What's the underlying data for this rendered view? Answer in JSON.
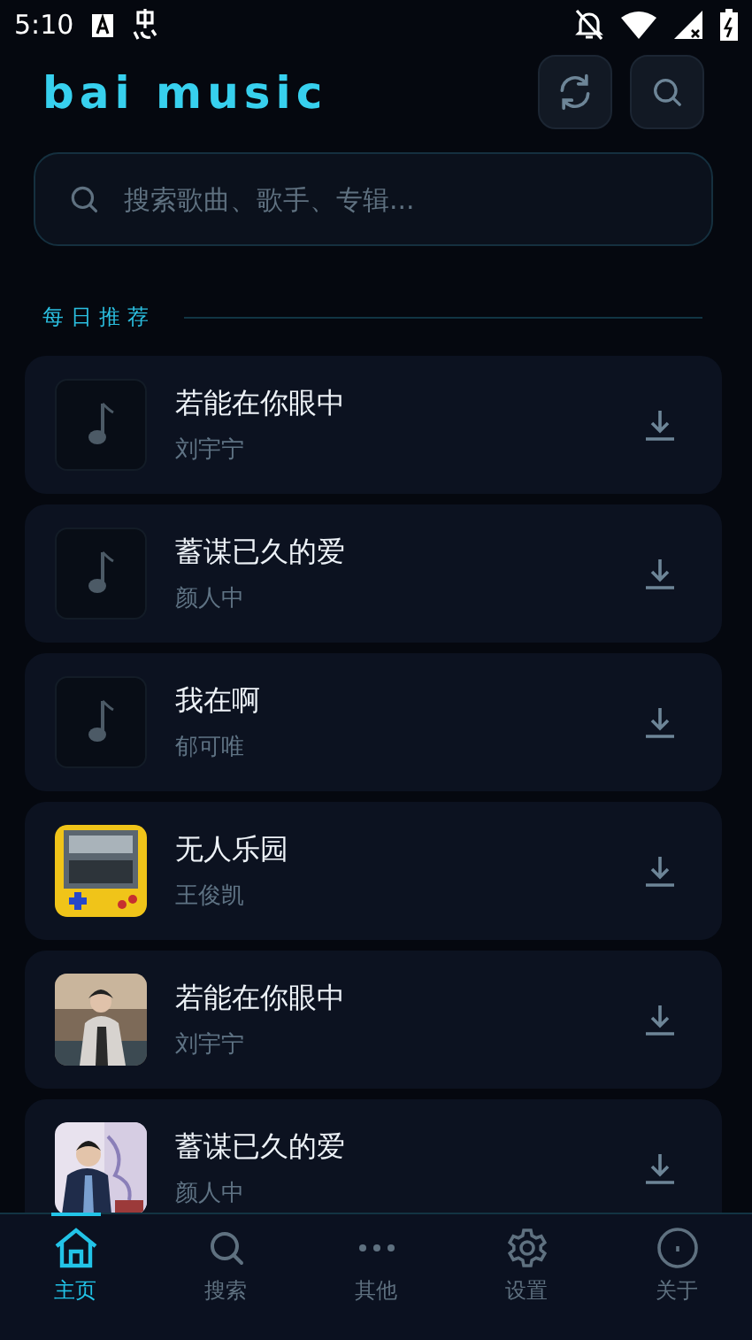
{
  "status_bar": {
    "time": "5:10"
  },
  "header": {
    "title": "bai music"
  },
  "search": {
    "placeholder": "搜索歌曲、歌手、专辑..."
  },
  "section": {
    "title": "每日推荐"
  },
  "songs": [
    {
      "title": "若能在你眼中",
      "artist": "刘宇宁",
      "kind": "note"
    },
    {
      "title": "蓄谋已久的爱",
      "artist": "颜人中",
      "kind": "note"
    },
    {
      "title": "我在啊",
      "artist": "郁可唯",
      "kind": "note"
    },
    {
      "title": "无人乐园",
      "artist": "王俊凯",
      "kind": "picture"
    },
    {
      "title": "若能在你眼中",
      "artist": "刘宇宁",
      "kind": "picture"
    },
    {
      "title": "蓄谋已久的爱",
      "artist": "颜人中",
      "kind": "picture"
    }
  ],
  "nav": [
    {
      "label": "主页",
      "selected": true
    },
    {
      "label": "搜索",
      "selected": false
    },
    {
      "label": "其他",
      "selected": false
    },
    {
      "label": "设置",
      "selected": false
    },
    {
      "label": "关于",
      "selected": false
    }
  ]
}
